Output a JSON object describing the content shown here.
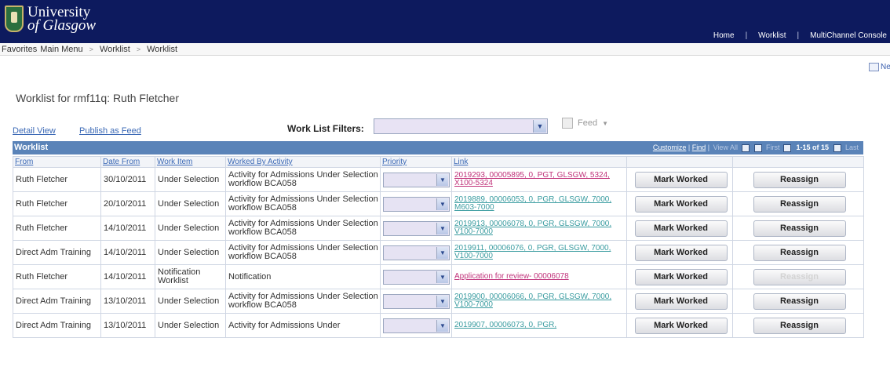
{
  "header": {
    "logo_line1": "University",
    "logo_line2": "of Glasgow",
    "nav": [
      "Home",
      "Worklist",
      "MultiChannel Console"
    ]
  },
  "breadcrumb": {
    "favorites": "Favorites",
    "main_menu": "Main Menu",
    "worklist1": "Worklist",
    "worklist2": "Worklist"
  },
  "new_window_label": "New",
  "page_title": "Worklist for rmf11q: Ruth Fletcher",
  "links": {
    "detail_view": "Detail View",
    "publish_feed": "Publish as Feed"
  },
  "filters": {
    "label": "Work List Filters:",
    "value": ""
  },
  "feed": {
    "label": "Feed"
  },
  "grid": {
    "title": "Worklist",
    "tools": {
      "customize": "Customize",
      "find": "Find",
      "view_all": "View All",
      "first": "First",
      "count": "1-15 of 15",
      "last": "Last"
    },
    "columns": [
      "From",
      "Date From",
      "Work Item",
      "Worked By Activity",
      "Priority",
      "Link"
    ],
    "rows": [
      {
        "from": "Ruth Fletcher",
        "date": "30/10/2011",
        "item": "Under Selection",
        "activity": "Activity for Admissions Under Selection workflow BCA058",
        "priority": "",
        "link": "2019293, 00005895, 0, PGT, GLSGW, 5324, X100-5324",
        "visited": true,
        "mark": "Mark Worked",
        "reassign": "Reassign",
        "reassign_disabled": false
      },
      {
        "from": "Ruth Fletcher",
        "date": "20/10/2011",
        "item": "Under Selection",
        "activity": "Activity for Admissions Under Selection workflow BCA058",
        "priority": "",
        "link": "2019889, 00006053, 0, PGR, GLSGW, 7000, M603-7000",
        "visited": false,
        "mark": "Mark Worked",
        "reassign": "Reassign",
        "reassign_disabled": false
      },
      {
        "from": "Ruth Fletcher",
        "date": "14/10/2011",
        "item": "Under Selection",
        "activity": "Activity for Admissions Under Selection workflow BCA058",
        "priority": "",
        "link": "2019913, 00006078, 0, PGR, GLSGW, 7000, V100-7000",
        "visited": false,
        "mark": "Mark Worked",
        "reassign": "Reassign",
        "reassign_disabled": false
      },
      {
        "from": "Direct Adm Training",
        "date": "14/10/2011",
        "item": "Under Selection",
        "activity": "Activity for Admissions Under Selection workflow BCA058",
        "priority": "",
        "link": "2019911, 00006076, 0, PGR, GLSGW, 7000, V100-7000",
        "visited": false,
        "mark": "Mark Worked",
        "reassign": "Reassign",
        "reassign_disabled": false
      },
      {
        "from": "Ruth Fletcher",
        "date": "14/10/2011",
        "item": "Notification Worklist",
        "activity": "Notification",
        "priority": "",
        "link": "Application for review- 00006078",
        "visited": true,
        "mark": "Mark Worked",
        "reassign": "Reassign",
        "reassign_disabled": true
      },
      {
        "from": "Direct Adm Training",
        "date": "13/10/2011",
        "item": "Under Selection",
        "activity": "Activity for Admissions Under Selection workflow BCA058",
        "priority": "",
        "link": "2019900, 00006066, 0, PGR, GLSGW, 7000, V100-7000",
        "visited": false,
        "mark": "Mark Worked",
        "reassign": "Reassign",
        "reassign_disabled": false
      },
      {
        "from": "Direct Adm Training",
        "date": "13/10/2011",
        "item": "Under Selection",
        "activity": "Activity for Admissions Under",
        "priority": "",
        "link": "2019907, 00006073, 0, PGR,",
        "visited": false,
        "mark": "Mark Worked",
        "reassign": "Reassign",
        "reassign_disabled": false
      }
    ]
  }
}
